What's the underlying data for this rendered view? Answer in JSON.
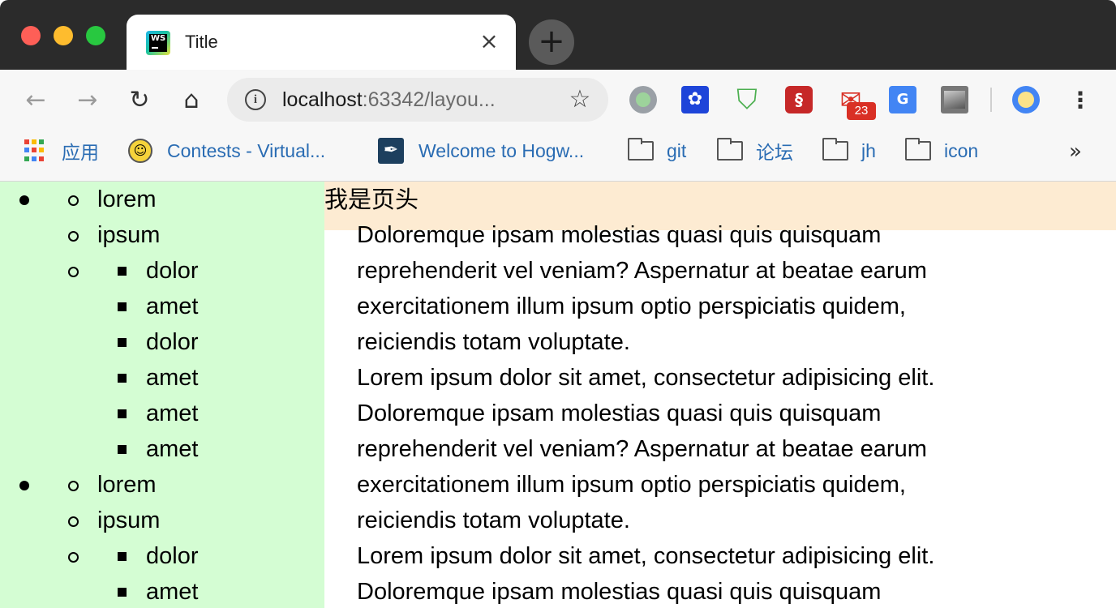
{
  "window": {
    "tab_title": "Title",
    "tab_close": "×",
    "new_tab": "+"
  },
  "toolbar": {
    "back": "←",
    "forward": "→",
    "reload": "↻",
    "home": "⌂",
    "info": "i",
    "url_host": "localhost",
    "url_rest": ":63342/layou...",
    "star": "☆",
    "mail_badge": "23",
    "menu": "⋮",
    "extensions": [
      "circle-extension-icon",
      "baidu-paw-icon",
      "adblock-shield-icon",
      "red-seal-icon",
      "gmail-icon",
      "google-translate-icon",
      "image-extension-icon",
      "profile-avatar-icon"
    ]
  },
  "bookmarks": {
    "items": [
      {
        "label": "应用",
        "icon": "apps-grid-icon"
      },
      {
        "label": "Contests - Virtual...",
        "icon": "smiley-icon"
      },
      {
        "label": "Welcome to Hogw...",
        "icon": "feather-icon"
      },
      {
        "label": "git",
        "icon": "folder-icon"
      },
      {
        "label": "论坛",
        "icon": "folder-icon"
      },
      {
        "label": "jh",
        "icon": "folder-icon"
      },
      {
        "label": "icon",
        "icon": "folder-icon"
      }
    ],
    "more": "»",
    "apps_colors": [
      "#ea4335",
      "#fbbc05",
      "#34a853",
      "#4285f4",
      "#ea4335",
      "#fbbc05",
      "#34a853",
      "#4285f4",
      "#ea4335"
    ]
  },
  "page": {
    "header": "我是页头",
    "sidebar_items": [
      {
        "level": 2,
        "disc": true,
        "text": "lorem"
      },
      {
        "level": 2,
        "disc": false,
        "text": "ipsum"
      },
      {
        "level": 3,
        "disc": false,
        "circle": true,
        "text": "dolor"
      },
      {
        "level": 3,
        "disc": false,
        "circle": false,
        "text": "amet"
      },
      {
        "level": 3,
        "disc": false,
        "circle": false,
        "text": "dolor"
      },
      {
        "level": 3,
        "disc": false,
        "circle": false,
        "text": "amet"
      },
      {
        "level": 3,
        "disc": false,
        "circle": false,
        "text": "amet"
      },
      {
        "level": 3,
        "disc": false,
        "circle": false,
        "text": "amet"
      },
      {
        "level": 2,
        "disc": true,
        "text": "lorem"
      },
      {
        "level": 2,
        "disc": false,
        "text": "ipsum"
      },
      {
        "level": 3,
        "disc": false,
        "circle": true,
        "text": "dolor"
      },
      {
        "level": 3,
        "disc": false,
        "circle": false,
        "text": "amet"
      }
    ],
    "content_lines": [
      "Doloremque ipsam molestias quasi quis quisquam",
      "reprehenderit vel veniam? Aspernatur at beatae earum",
      "exercitationem illum ipsum optio perspiciatis quidem,",
      "reiciendis totam voluptate.",
      "Lorem ipsum dolor sit amet, consectetur adipisicing elit.",
      "Doloremque ipsam molestias quasi quis quisquam",
      "reprehenderit vel veniam? Aspernatur at beatae earum",
      "exercitationem illum ipsum optio perspiciatis quidem,",
      "reiciendis totam voluptate.",
      "Lorem ipsum dolor sit amet, consectetur adipisicing elit.",
      "Doloremque ipsam molestias quasi quis quisquam"
    ]
  }
}
